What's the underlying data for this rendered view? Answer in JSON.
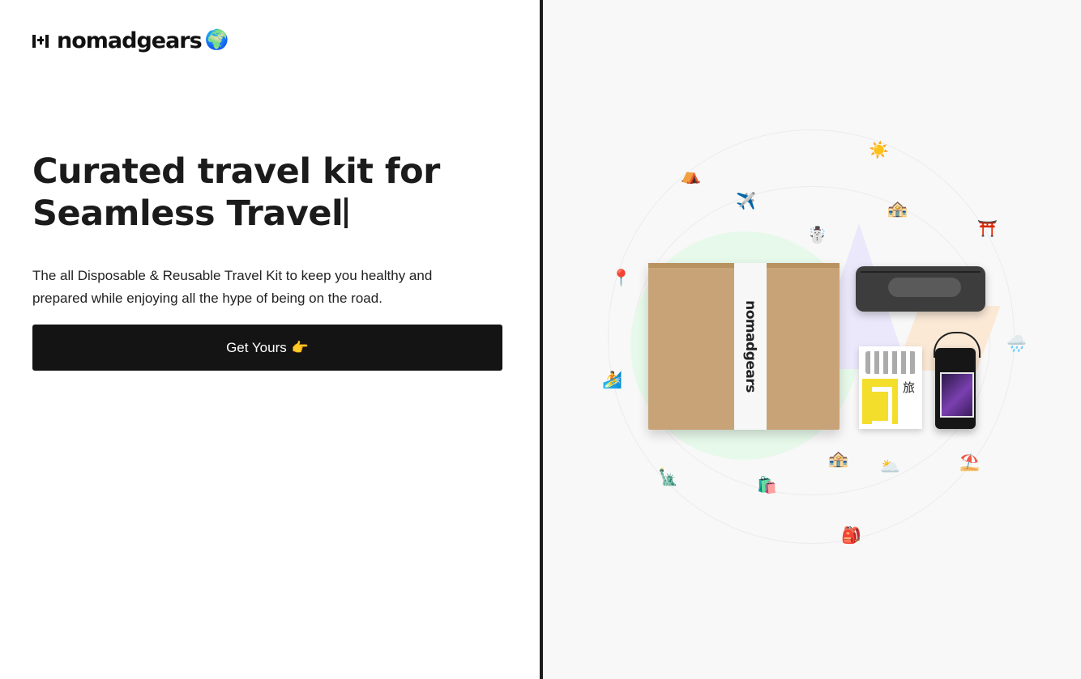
{
  "brand": {
    "name": "nomadgears",
    "globe": "🌍"
  },
  "hero": {
    "title_line1": "Curated travel kit for",
    "title_line2": "Seamless Travel",
    "description": "The all Disposable & Reusable Travel Kit to keep you healthy and prepared while enjoying all the hype of being on the road.",
    "cta_label": "Get Yours",
    "cta_emoji": "👉"
  },
  "illustration": {
    "box_tape_text": "nomadgears",
    "pads_kanji": "旅",
    "icons": {
      "sun": "☀️",
      "tent": "⛺",
      "airplane": "✈️",
      "building": "🏤",
      "torii": "⛩️",
      "snowman": "☃️",
      "pin": "📍",
      "rain_cloud": "🌧️",
      "surfer": "🏄",
      "liberty": "🗽",
      "shopping": "🛍️",
      "building2": "🏤",
      "cloud_sun": "🌥️",
      "beach": "⛱️",
      "backpack": "🎒"
    }
  }
}
